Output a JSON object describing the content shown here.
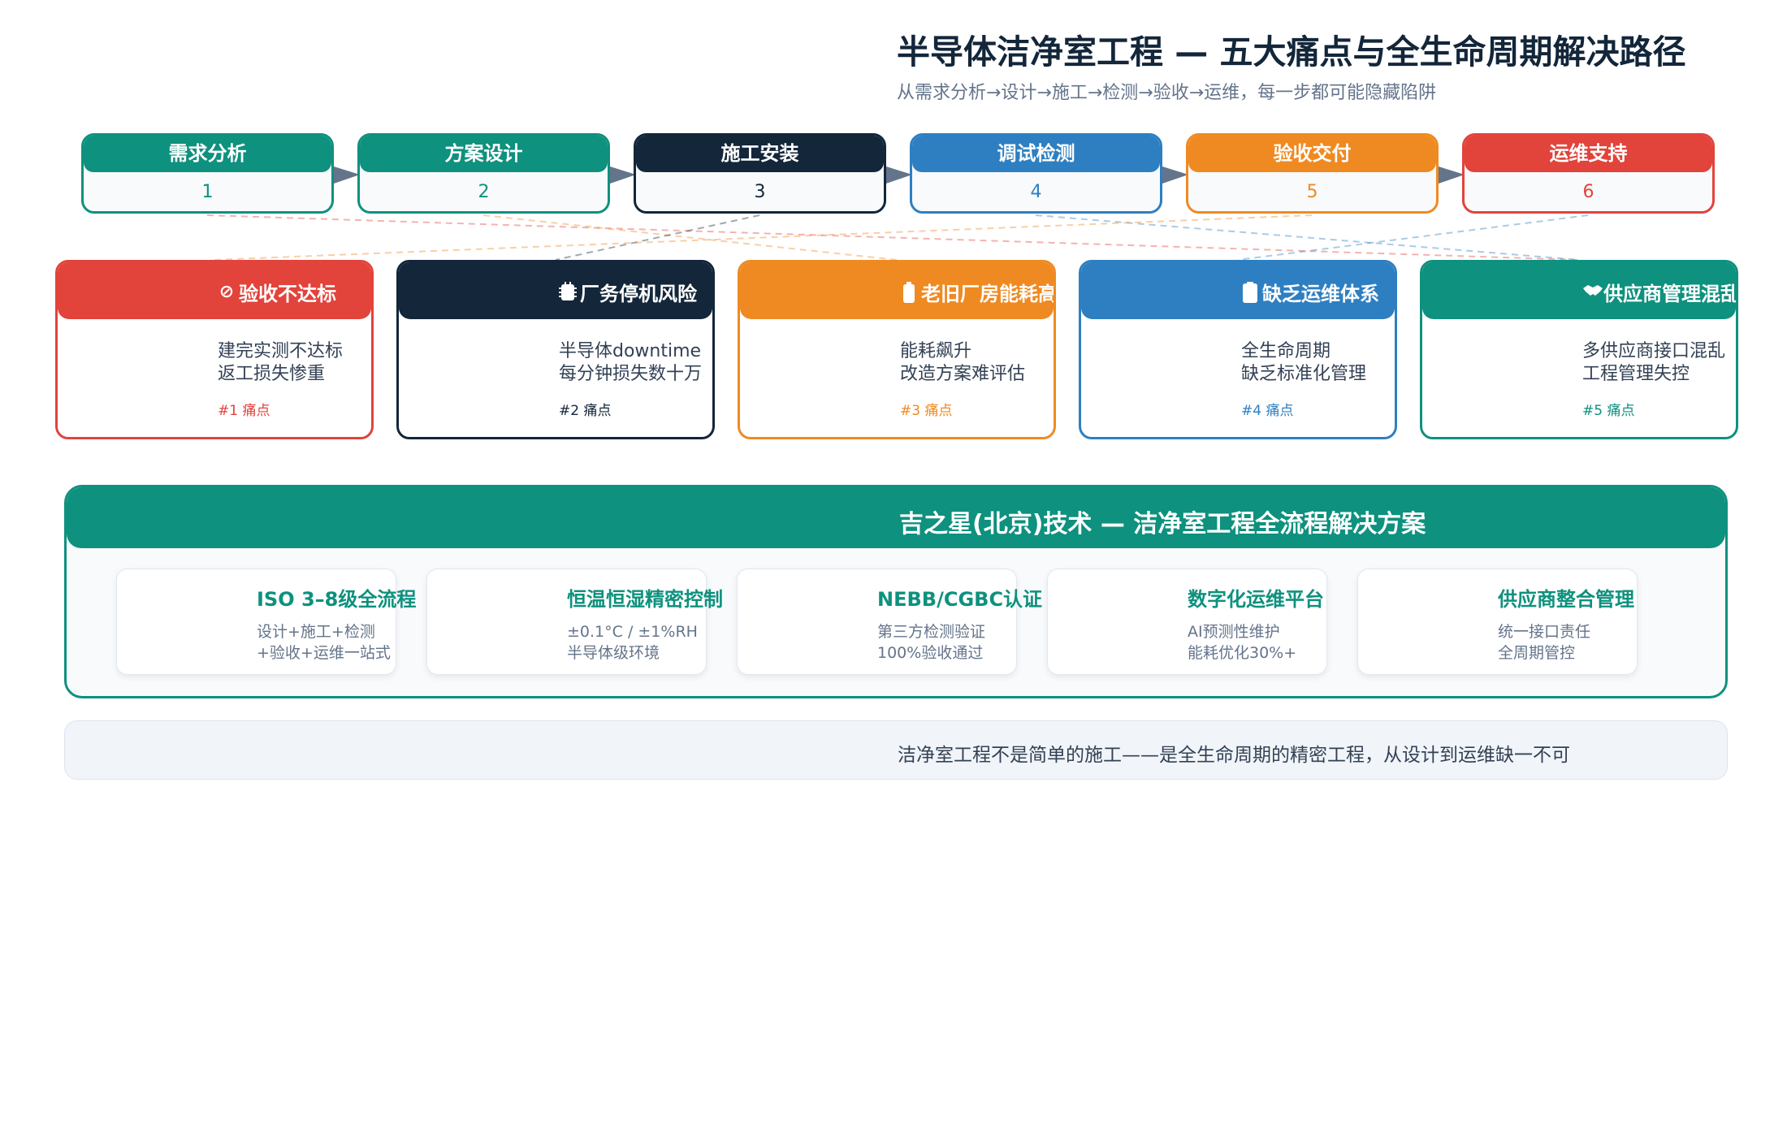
{
  "header": {
    "title": "半导体洁净室工程 — 五大痛点与全生命周期解决路径",
    "subtitle": "从需求分析→设计→施工→检测→验收→运维，每一步都可能隐藏陷阱"
  },
  "steps": [
    {
      "label": "需求分析",
      "num": "1",
      "color": "#0e917e"
    },
    {
      "label": "方案设计",
      "num": "2",
      "color": "#0e917e"
    },
    {
      "label": "施工安装",
      "num": "3",
      "color": "#13263a"
    },
    {
      "label": "调试检测",
      "num": "4",
      "color": "#2e7fc1"
    },
    {
      "label": "验收交付",
      "num": "5",
      "color": "#ef8a22"
    },
    {
      "label": "运维支持",
      "num": "6",
      "color": "#e2433b"
    }
  ],
  "pains": [
    {
      "title": "验收不达标",
      "icon": "prohibit-icon",
      "glyph": "⊘",
      "line1": "建完实测不达标",
      "line2": "返工损失惨重",
      "tag": "#1 痛点",
      "color": "#e2433b"
    },
    {
      "title": "厂务停机风险",
      "icon": "chip-icon",
      "glyph": "",
      "line1": "半导体downtime",
      "line2": "每分钟损失数十万",
      "tag": "#2 痛点",
      "color": "#13263a"
    },
    {
      "title": "老旧厂房能耗高",
      "icon": "battery-icon",
      "glyph": "",
      "line1": "能耗飙升",
      "line2": "改造方案难评估",
      "tag": "#3 痛点",
      "color": "#ef8a22"
    },
    {
      "title": "缺乏运维体系",
      "icon": "clipboard-icon",
      "glyph": "",
      "line1": "全生命周期",
      "line2": "缺乏标准化管理",
      "tag": "#4 痛点",
      "color": "#2e7fc1"
    },
    {
      "title": "供应商管理混乱",
      "icon": "handshake-icon",
      "glyph": "🤝",
      "line1": "多供应商接口混乱",
      "line2": "工程管理失控",
      "tag": "#5 痛点",
      "color": "#0e917e"
    }
  ],
  "solution": {
    "title": "吉之星(北京)技术 — 洁净室工程全流程解决方案",
    "color": "#0e917e",
    "cards": [
      {
        "title": "ISO 3–8级全流程",
        "line1": "设计+施工+检测",
        "line2": "+验收+运维一站式"
      },
      {
        "title": "恒温恒湿精密控制",
        "line1": "±0.1°C / ±1%RH",
        "line2": "半导体级环境"
      },
      {
        "title": "NEBB/CGBC认证",
        "line1": "第三方检测验证",
        "line2": "100%验收通过"
      },
      {
        "title": "数字化运维平台",
        "line1": "AI预测性维护",
        "line2": "能耗优化30%+"
      },
      {
        "title": "供应商整合管理",
        "line1": "统一接口责任",
        "line2": "全周期管控"
      }
    ]
  },
  "footer": {
    "text": "洁净室工程不是简单的施工——是全生命周期的精密工程，从设计到运维缺一不可"
  }
}
